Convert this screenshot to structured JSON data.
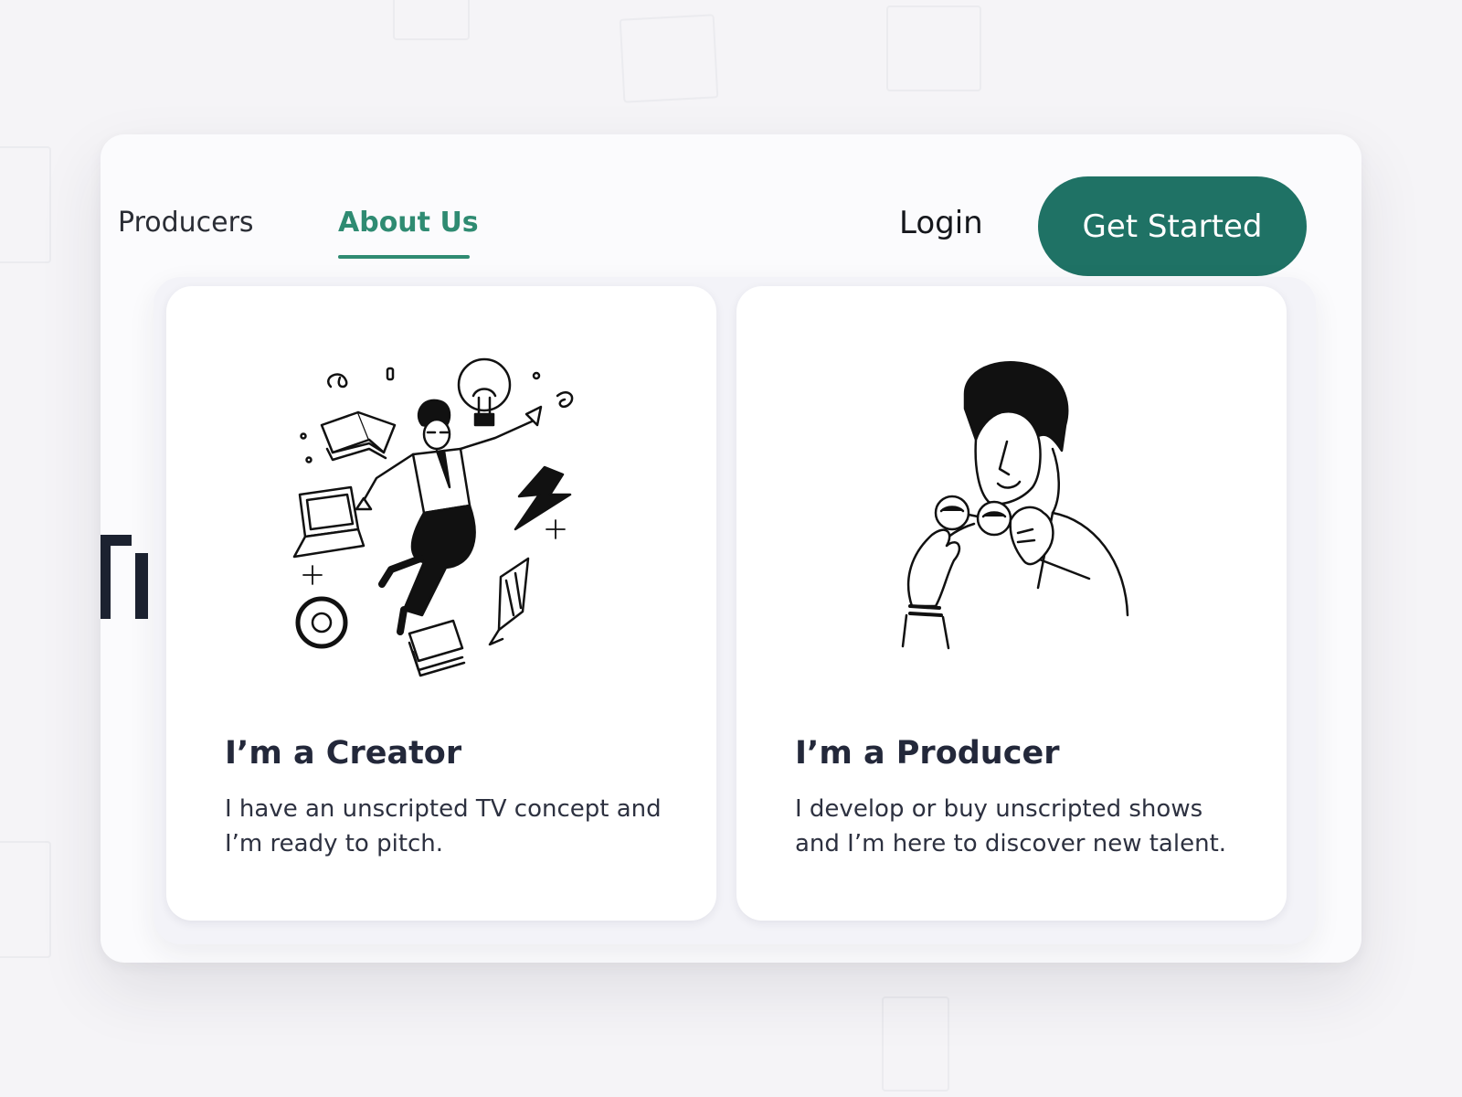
{
  "nav": {
    "producers_label": "Producers",
    "about_label": "About Us",
    "login_label": "Login",
    "get_started_label": "Get Started",
    "active_tab": "About Us"
  },
  "dropdown": {
    "cards": [
      {
        "title": "I’m a Creator",
        "description": "I have an unscripted TV concept and I’m ready to pitch.",
        "icon": "creator-illustration-icon"
      },
      {
        "title": "I’m a Producer",
        "description": "I develop or buy unscripted shows and I’m here to discover new talent.",
        "icon": "producer-illustration-icon"
      }
    ]
  },
  "colors": {
    "accent": "#2f8b72",
    "button_bg": "#1f7265",
    "button_text": "#ffffff",
    "panel_bg": "#fbfbfd",
    "card_bg": "#ffffff",
    "heading_text": "#23283a"
  }
}
